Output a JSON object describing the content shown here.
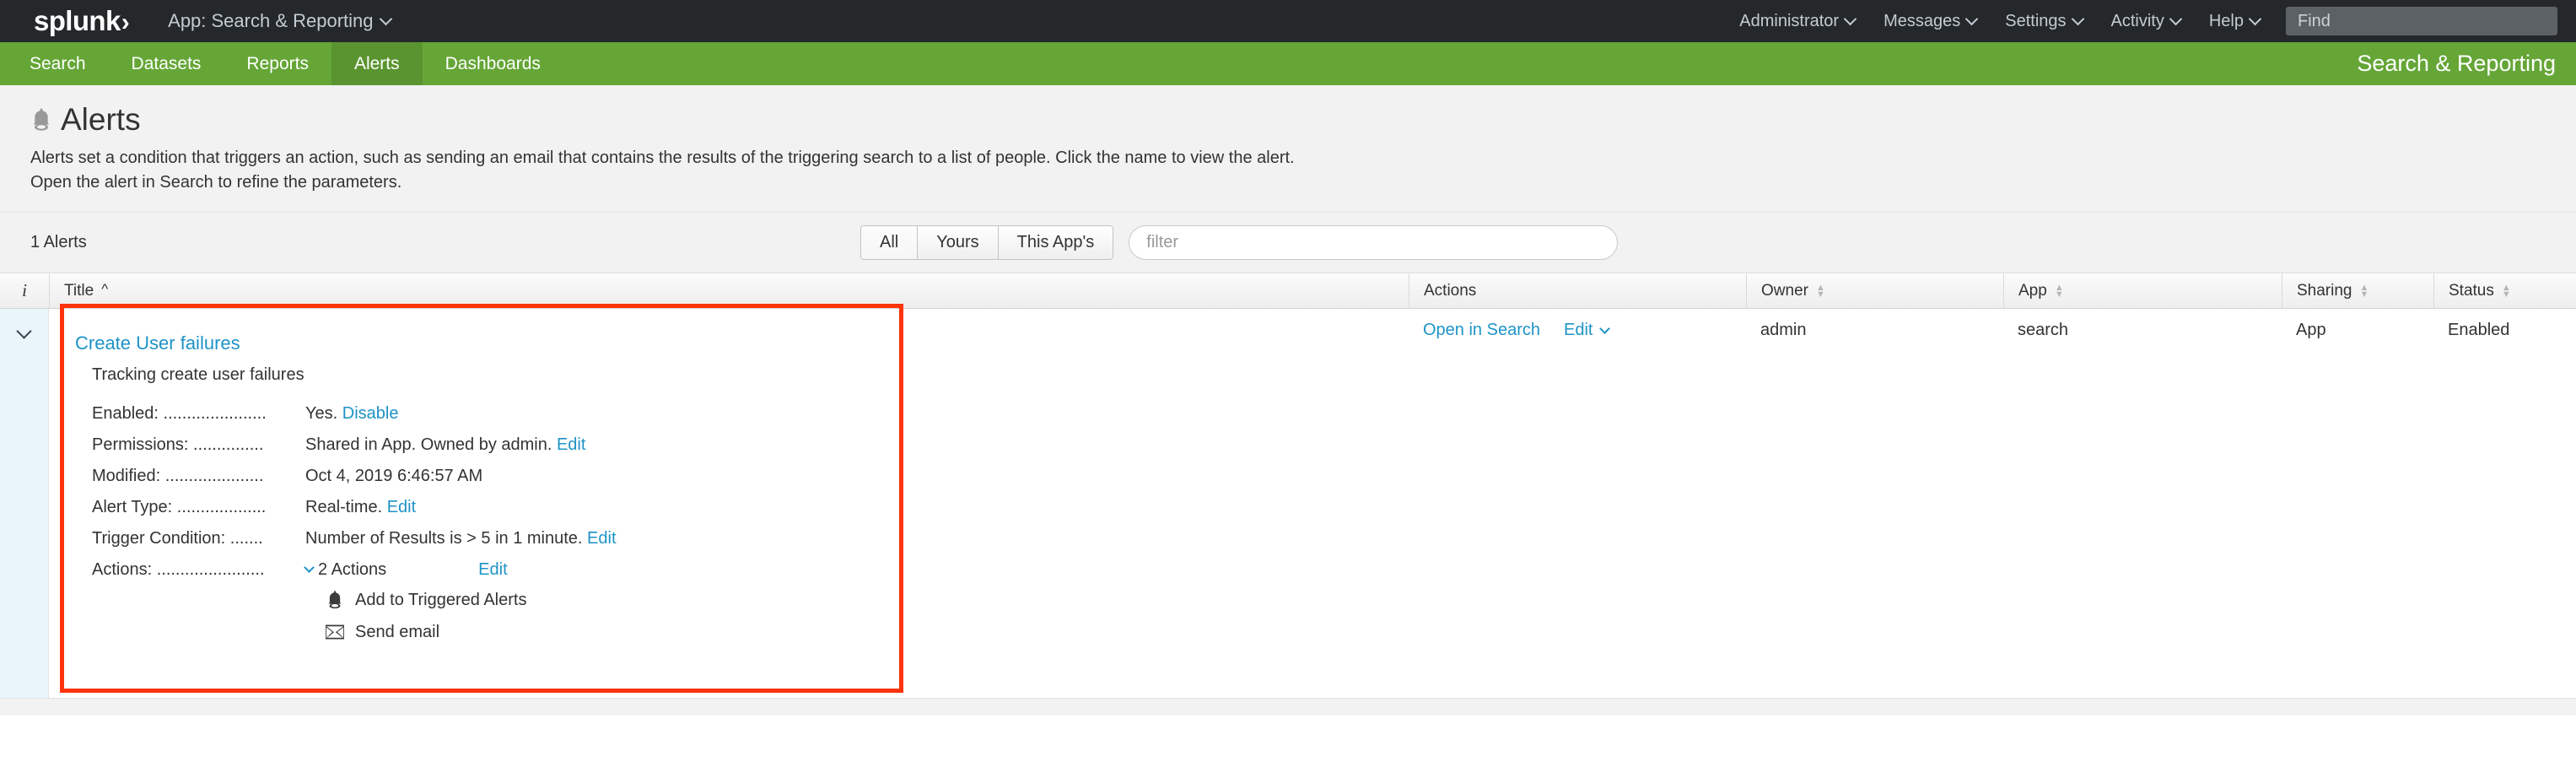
{
  "topbar": {
    "logo_text": "splunk",
    "logo_mark": "›",
    "app_selector": "App: Search & Reporting",
    "items": [
      {
        "label": "Administrator",
        "icon": "chevron-down-icon"
      },
      {
        "label": "Messages",
        "icon": "chevron-down-icon"
      },
      {
        "label": "Settings",
        "icon": "chevron-down-icon"
      },
      {
        "label": "Activity",
        "icon": "chevron-down-icon"
      },
      {
        "label": "Help",
        "icon": "chevron-down-icon"
      }
    ],
    "find_placeholder": "Find"
  },
  "greenbar": {
    "items": [
      {
        "label": "Search",
        "active": false
      },
      {
        "label": "Datasets",
        "active": false
      },
      {
        "label": "Reports",
        "active": false
      },
      {
        "label": "Alerts",
        "active": true
      },
      {
        "label": "Dashboards",
        "active": false
      }
    ],
    "app_name": "Search & Reporting",
    "color": "#65a637",
    "active_color": "#5a9430"
  },
  "page": {
    "title": "Alerts",
    "title_icon": "bell-icon",
    "description": "Alerts set a condition that triggers an action, such as sending an email that contains the results of the triggering search to a list of people. Click the name to view the alert. Open the alert in Search to refine the parameters."
  },
  "toolbar": {
    "count_label": "1 Alerts",
    "filters": [
      {
        "label": "All",
        "selected": true
      },
      {
        "label": "Yours",
        "selected": false
      },
      {
        "label": "This App's",
        "selected": false
      }
    ],
    "filter_placeholder": "filter",
    "filter_value": ""
  },
  "table": {
    "columns": [
      {
        "key": "i",
        "label": "i",
        "sort": "none"
      },
      {
        "key": "title",
        "label": "Title",
        "sort": "asc"
      },
      {
        "key": "actions",
        "label": "Actions",
        "sort": "none"
      },
      {
        "key": "owner",
        "label": "Owner",
        "sort": "sortable"
      },
      {
        "key": "app",
        "label": "App",
        "sort": "sortable"
      },
      {
        "key": "sharing",
        "label": "Sharing",
        "sort": "sortable"
      },
      {
        "key": "status",
        "label": "Status",
        "sort": "sortable"
      }
    ],
    "row": {
      "title": "Create User failures",
      "description": "Tracking create user failures",
      "details": [
        {
          "key": "Enabled: ......................",
          "value": "Yes.",
          "link": "Disable"
        },
        {
          "key": "Permissions: ...............",
          "value": "Shared in App. Owned by admin.",
          "link": "Edit"
        },
        {
          "key": "Modified: .....................",
          "value": "Oct 4, 2019 6:46:57 AM",
          "link": ""
        },
        {
          "key": "Alert Type: ...................",
          "value": "Real-time.",
          "link": "Edit"
        },
        {
          "key": "Trigger Condition: .......",
          "value": "Number of Results is > 5 in 1 minute.",
          "link": "Edit"
        }
      ],
      "actions_row": {
        "key": "Actions: .......................",
        "toggle_label": "2 Actions",
        "edit_label": "Edit",
        "items": [
          {
            "icon": "bell-icon",
            "label": "Add to Triggered Alerts"
          },
          {
            "icon": "envelope-icon",
            "label": "Send email"
          }
        ]
      },
      "open_in_search": "Open in Search",
      "edit": "Edit",
      "owner": "admin",
      "app": "search",
      "sharing": "App",
      "status": "Enabled"
    }
  },
  "highlight": {
    "color": "#fc3409"
  }
}
